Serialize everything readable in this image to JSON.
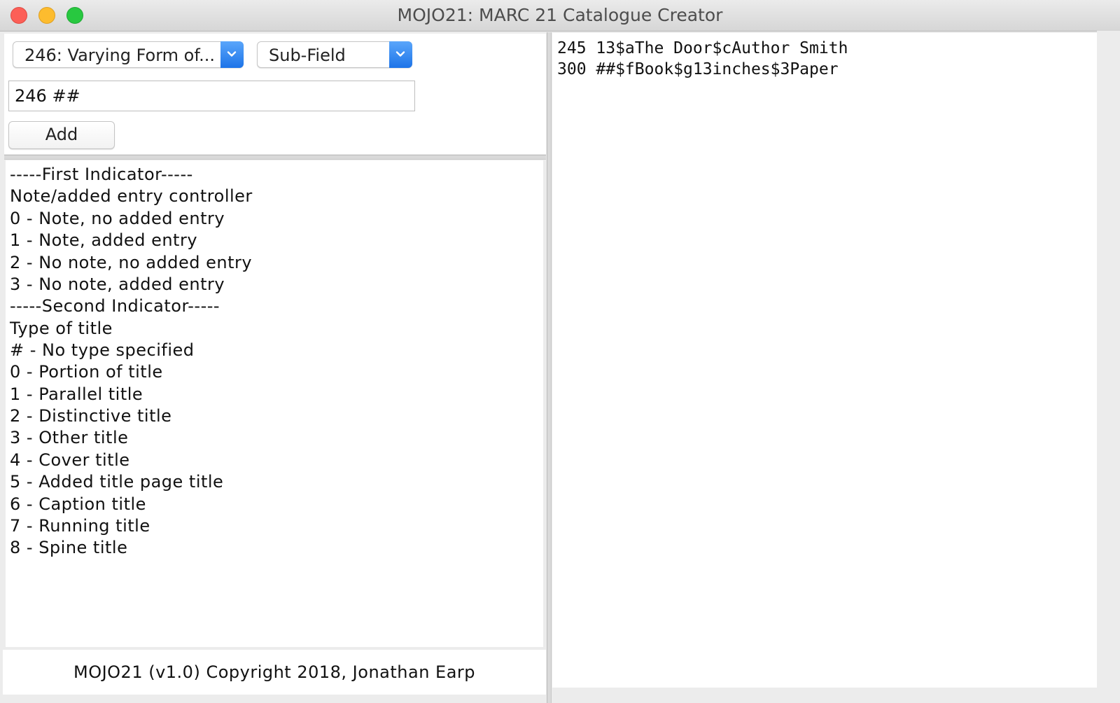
{
  "window": {
    "title": "MOJO21: MARC 21 Catalogue Creator"
  },
  "controls": {
    "field_select": "246: Varying Form of...",
    "subfield_select": "Sub-Field",
    "input_value": "246 ##",
    "add_label": "Add"
  },
  "info_lines": [
    "-----First Indicator-----",
    "Note/added entry controller",
    "0 - Note, no added entry",
    "1 - Note, added entry",
    "2 - No note, no added entry",
    "3 - No note, added entry",
    "-----Second Indicator-----",
    "Type of title",
    "# - No type specified",
    "0 - Portion of title",
    "1 - Parallel title",
    "2 - Distinctive title",
    "3 - Other title",
    "4 - Cover title",
    "5 - Added title page title",
    "6 - Caption title",
    "7 - Running title",
    "8 - Spine title"
  ],
  "footer": "MOJO21 (v1.0) Copyright 2018, Jonathan Earp",
  "record_lines": [
    "245 13$aThe Door$cAuthor Smith",
    "300 ##$fBook$g13inches$3Paper"
  ],
  "colors": {
    "close": "#fc5f57",
    "minimize": "#fdbc2e",
    "maximize": "#28c840",
    "select_arrow": "#2a7cf0"
  },
  "icons": {
    "select_arrow": "chevron-down-icon"
  }
}
